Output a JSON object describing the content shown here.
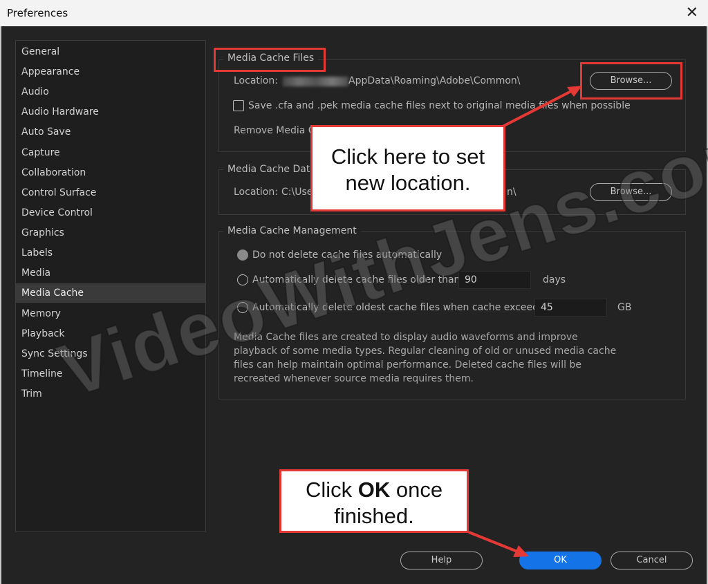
{
  "window": {
    "title": "Preferences",
    "close_glyph": "✕"
  },
  "sidebar": {
    "items": [
      {
        "label": "General"
      },
      {
        "label": "Appearance"
      },
      {
        "label": "Audio"
      },
      {
        "label": "Audio Hardware"
      },
      {
        "label": "Auto Save"
      },
      {
        "label": "Capture"
      },
      {
        "label": "Collaboration"
      },
      {
        "label": "Control Surface"
      },
      {
        "label": "Device Control"
      },
      {
        "label": "Graphics"
      },
      {
        "label": "Labels"
      },
      {
        "label": "Media"
      },
      {
        "label": "Media Cache"
      },
      {
        "label": "Memory"
      },
      {
        "label": "Playback"
      },
      {
        "label": "Sync Settings"
      },
      {
        "label": "Timeline"
      },
      {
        "label": "Trim"
      }
    ],
    "selected": "Media Cache"
  },
  "media_cache_files": {
    "title": "Media Cache Files",
    "location_label": "Location:",
    "location_path": "AppData\\Roaming\\Adobe\\Common\\",
    "browse_label": "Browse...",
    "checkbox_label": "Save .cfa and .pek media cache files next to original media files when possible",
    "checkbox_checked": false,
    "remove_label": "Remove Media C"
  },
  "media_cache_database": {
    "title": "Media Cache Data",
    "location_label": "Location:",
    "location_path_start": "C:\\Use",
    "location_path_end": "n\\",
    "browse_label": "Browse..."
  },
  "media_cache_management": {
    "title": "Media Cache Management",
    "option_none": "Do not delete cache files automatically",
    "option_older": "Automatically delete cache files older than:",
    "older_value": "90",
    "older_unit": "days",
    "option_exceeds": "Automatically delete oldest cache files when cache exceeds:",
    "exceeds_value": "45",
    "exceeds_unit": "GB",
    "selected_option": "none",
    "description": "Media Cache files are created to display audio waveforms and improve playback of some media types.  Regular cleaning of old or unused media cache files can help maintain optimal performance. Deleted cache files will be recreated whenever source media requires them."
  },
  "footer": {
    "help_label": "Help",
    "ok_label": "OK",
    "cancel_label": "Cancel"
  },
  "annotations": {
    "callout_browse": "Click here to set new location.",
    "callout_ok_prefix": "Click ",
    "callout_ok_bold": "OK",
    "callout_ok_suffix": " once finished.",
    "watermark": "VideoWithJens.com"
  },
  "colors": {
    "accent": "#1473e6",
    "annotation_red": "#e53935",
    "background": "#232323"
  }
}
